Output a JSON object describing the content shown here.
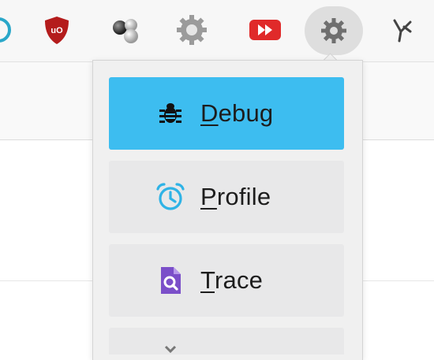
{
  "toolbar": {
    "extensions": [
      {
        "name": "partial-circle-extension"
      },
      {
        "name": "ublock-origin-extension",
        "badge": "uO"
      },
      {
        "name": "molecule-extension"
      },
      {
        "name": "settings-gear-extension"
      },
      {
        "name": "fast-forward-extension"
      },
      {
        "name": "devtools-bug-extension",
        "active": true
      },
      {
        "name": "branch-extension"
      }
    ]
  },
  "menu": {
    "items": [
      {
        "label_mnemonic": "D",
        "label_rest": "ebug",
        "icon": "bug-icon",
        "selected": true
      },
      {
        "label_mnemonic": "P",
        "label_rest": "rofile",
        "icon": "alarm-clock-icon",
        "selected": false
      },
      {
        "label_mnemonic": "T",
        "label_rest": "race",
        "icon": "document-search-icon",
        "selected": false
      },
      {
        "label_mnemonic": "",
        "label_rest": "",
        "icon": "partially-visible-icon",
        "selected": false
      }
    ]
  },
  "colors": {
    "selected": "#3dbdf0",
    "item_bg": "#e8e8e9",
    "profile_icon": "#2fb3e6",
    "trace_icon": "#7b4fc9",
    "ublock_red": "#b41c1c"
  }
}
